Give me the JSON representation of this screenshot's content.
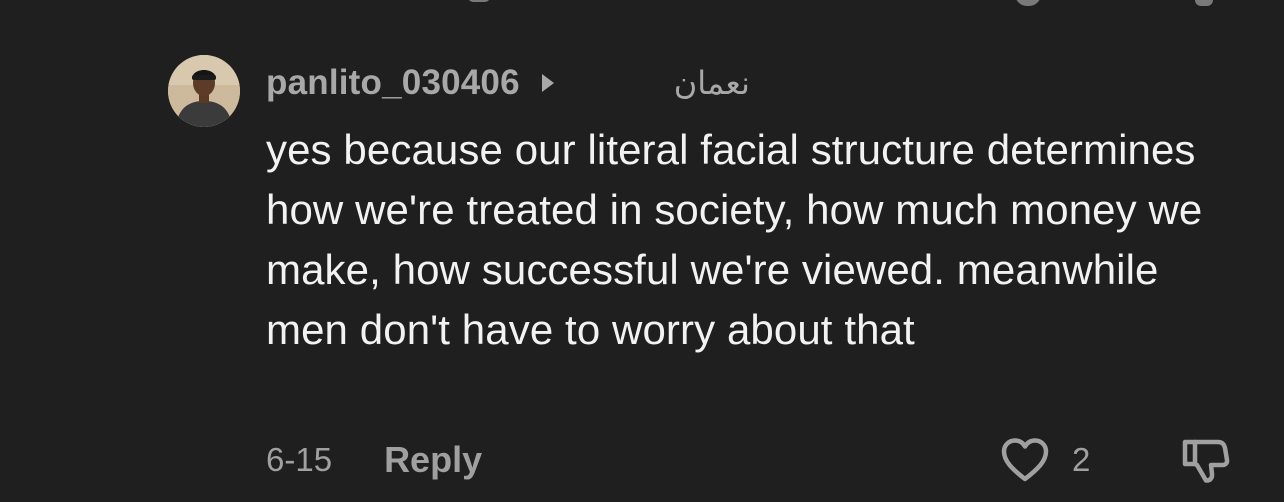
{
  "comment": {
    "username": "panlito_030406",
    "translation_label": "نعمان",
    "text": "yes because our literal facial structure determines how we're treated in society, how much money we make, how successful we're viewed. meanwhile men don't have to worry about that",
    "date": "6-15",
    "reply_label": "Reply",
    "like_count": "2",
    "icons": {
      "like": "heart-outline-icon",
      "dislike": "thumbs-down-outline-icon",
      "expand": "caret-right-icon"
    }
  },
  "colors": {
    "background": "#1f1f1f",
    "primary_text": "#f2f2f2",
    "secondary_text": "#a0a0a0"
  }
}
